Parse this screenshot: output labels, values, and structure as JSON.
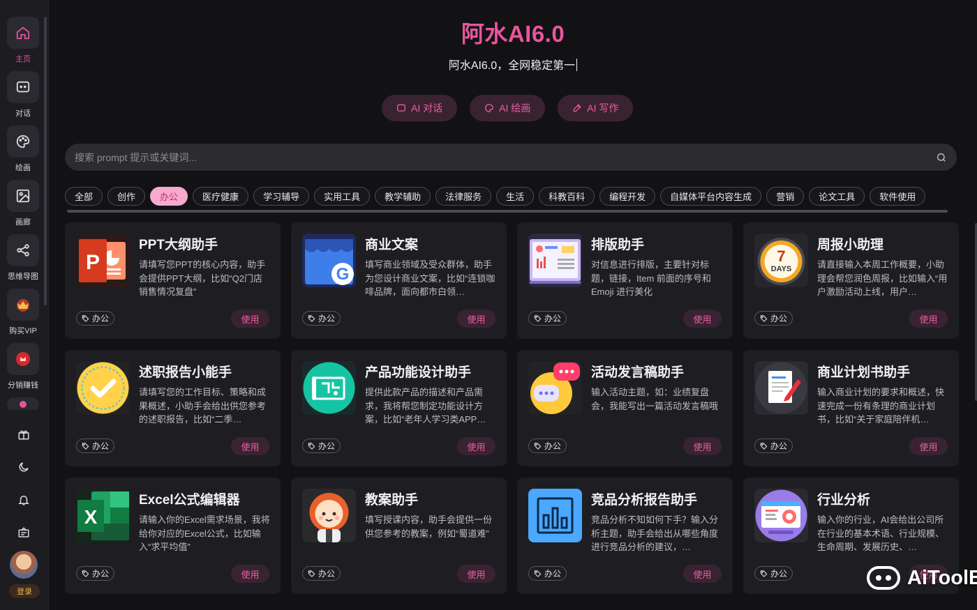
{
  "sidebar": {
    "items": [
      {
        "label": "主页",
        "icon": "home-icon"
      },
      {
        "label": "对话",
        "icon": "chat-icon"
      },
      {
        "label": "绘画",
        "icon": "palette-icon"
      },
      {
        "label": "画廊",
        "icon": "gallery-icon"
      },
      {
        "label": "思维导图",
        "icon": "mindmap-icon"
      },
      {
        "label": "购买VIP",
        "icon": "vip-crown-icon"
      },
      {
        "label": "分销赚钱",
        "icon": "affiliate-icon"
      }
    ],
    "utility_icons": [
      "gift-icon",
      "moon-icon",
      "bell-icon",
      "notice-icon"
    ],
    "login_label": "登录"
  },
  "header": {
    "title": "阿水AI6.0",
    "subtitle": "阿水AI6.0，全网稳定第一"
  },
  "modes": [
    {
      "label": "AI 对话",
      "icon": "chat-icon"
    },
    {
      "label": "AI 绘画",
      "icon": "palette-icon"
    },
    {
      "label": "AI 写作",
      "icon": "pen-icon"
    }
  ],
  "search": {
    "placeholder": "搜索 prompt 提示或关键词..."
  },
  "categories": [
    "全部",
    "创作",
    "办公",
    "医疗健康",
    "学习辅导",
    "实用工具",
    "教学辅助",
    "法律服务",
    "生活",
    "科教百科",
    "编程开发",
    "自媒体平台内容生成",
    "营销",
    "论文工具",
    "软件使用"
  ],
  "active_category": "办公",
  "cards": [
    {
      "title": "PPT大纲助手",
      "desc": "请填写您PPT的核心内容，助手会提供PPT大纲，比如“Q2门店销售情况复盘”",
      "tag": "办公",
      "use": "使用",
      "icon": "powerpoint-icon"
    },
    {
      "title": "商业文案",
      "desc": "填写商业领域及受众群体，助手为您设计商业文案，比如“连锁咖啡品牌，面向都市白领…",
      "tag": "办公",
      "use": "使用",
      "icon": "google-store-icon"
    },
    {
      "title": "排版助手",
      "desc": "对信息进行排版，主要针对标题，链接，Item 前面的序号和 Emoji 进行美化",
      "tag": "办公",
      "use": "使用",
      "icon": "layout-icon"
    },
    {
      "title": "周报小助理",
      "desc": "请直接输入本周工作概要，小助理会帮您润色周报，比如输入“用户激励活动上线，用户…",
      "tag": "办公",
      "use": "使用",
      "icon": "7days-icon"
    },
    {
      "title": "述职报告小能手",
      "desc": "请填写您的工作目标、策略和成果概述，小助手会给出供您参考的述职报告，比如“二季…",
      "tag": "办公",
      "use": "使用",
      "icon": "checkmark-icon"
    },
    {
      "title": "产品功能设计助手",
      "desc": "提供此款产品的描述和产品需求，我将帮您制定功能设计方案，比如“老年人学习类APP…",
      "tag": "办公",
      "use": "使用",
      "icon": "blueprint-icon"
    },
    {
      "title": "活动发言稿助手",
      "desc": "输入活动主题，如：业绩复盘会，我能写出一篇活动发言稿哦",
      "tag": "办公",
      "use": "使用",
      "icon": "speech-bubble-icon"
    },
    {
      "title": "商业计划书助手",
      "desc": "输入商业计划的要求和概述，快速完成一份有条理的商业计划书，比如“关于家庭陪伴机…",
      "tag": "办公",
      "use": "使用",
      "icon": "document-pen-icon"
    },
    {
      "title": "Excel公式编辑器",
      "desc": "请输入你的Excel需求场景，我将给你对应的Excel公式，比如输入“求平均值”",
      "tag": "办公",
      "use": "使用",
      "icon": "excel-icon"
    },
    {
      "title": "教案助手",
      "desc": "填写授课内容，助手会提供一份供您参考的教案，例如“蜀道难”",
      "tag": "办公",
      "use": "使用",
      "icon": "teacher-avatar-icon"
    },
    {
      "title": "竞品分析报告助手",
      "desc": "竞品分析不知如何下手？输入分析主题，助手会给出从哪些角度进行竞品分析的建议，…",
      "tag": "办公",
      "use": "使用",
      "icon": "bar-chart-icon"
    },
    {
      "title": "行业分析",
      "desc": "输入你的行业，AI会给出公司所在行业的基本术语、行业规模、生命周期、发展历史、…",
      "tag": "办公",
      "use": "使用",
      "icon": "analytics-icon"
    }
  ],
  "watermark": "AiToolBox",
  "colors": {
    "accent": "#e9559d",
    "background": "#121215",
    "card": "#1e1e22",
    "sidebar": "#1c1c21"
  }
}
